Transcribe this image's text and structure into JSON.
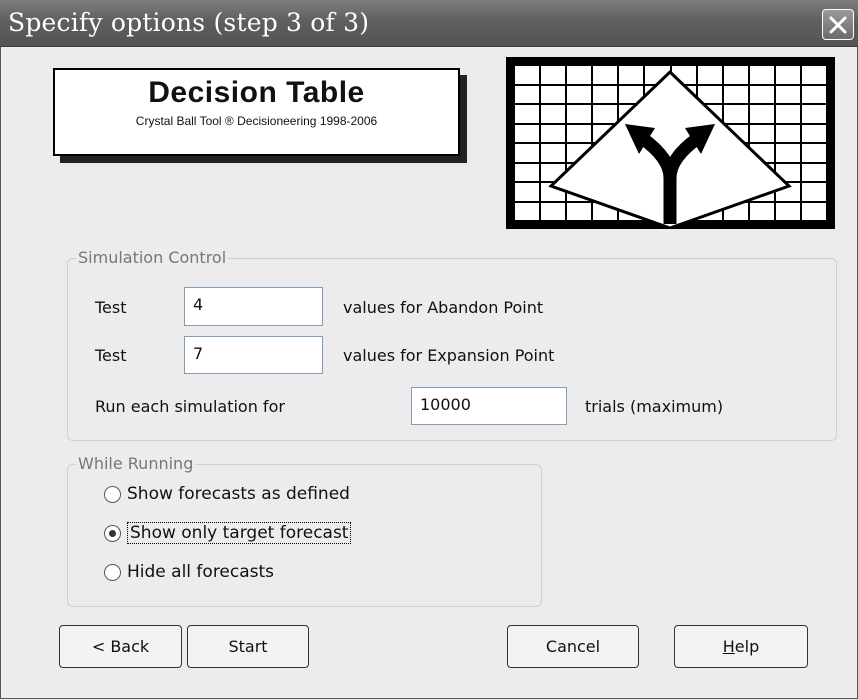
{
  "window": {
    "title": "Specify options (step 3 of 3)"
  },
  "logo": {
    "title": "Decision Table",
    "subtitle": "Crystal Ball Tool ® Decisioneering 1998-2006"
  },
  "simulation_control": {
    "legend": "Simulation Control",
    "row1": {
      "prefix": "Test",
      "value": "4",
      "suffix": "values for Abandon Point"
    },
    "row2": {
      "prefix": "Test",
      "value": "7",
      "suffix": "values for Expansion Point"
    },
    "row3": {
      "prefix": "Run each simulation for",
      "value": "10000",
      "suffix": "trials (maximum)"
    }
  },
  "while_running": {
    "legend": "While Running",
    "options": [
      {
        "label": "Show forecasts as defined",
        "selected": false
      },
      {
        "label": "Show only target forecast",
        "selected": true
      },
      {
        "label": "Hide all forecasts",
        "selected": false
      }
    ]
  },
  "buttons": {
    "back": "< Back",
    "start": "Start",
    "cancel": "Cancel",
    "help_mnemonic": "H",
    "help_rest": "elp"
  },
  "icons": {
    "close": "close-icon",
    "decision": "fork-arrow-icon"
  }
}
